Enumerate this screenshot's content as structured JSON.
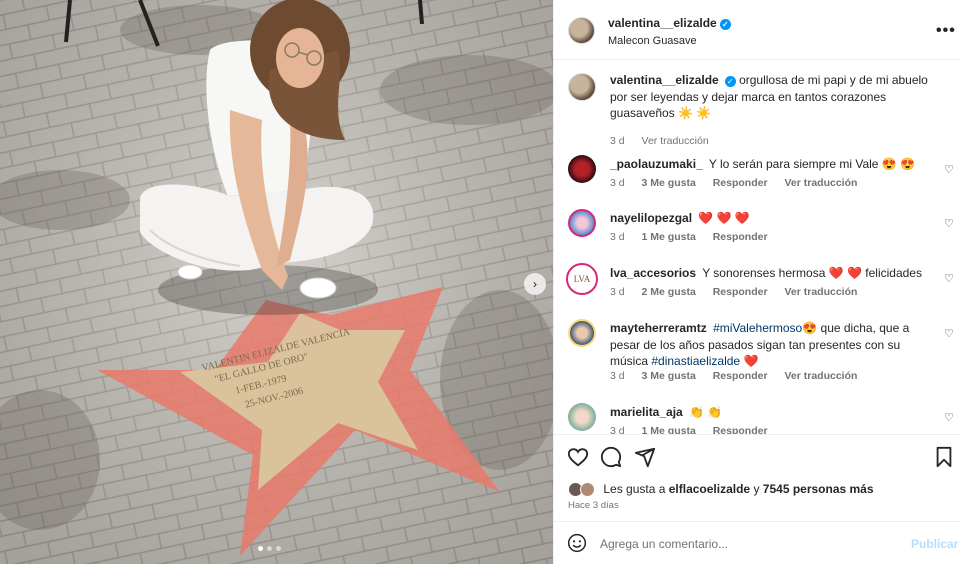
{
  "post": {
    "author": "valentina__elizalde",
    "location": "Malecon Guasave",
    "more_icon": "more-horizontal-icon",
    "caption": "orgullosa de mi papi y de mi abuelo por ser leyendas y dejar marca en tantos corazones guasaveños",
    "caption_emoji": "☀️ ☀️",
    "caption_time": "3 d",
    "caption_translate": "Ver traducción",
    "star_plaque": {
      "line1": "VALENTIN ELIZALDE VALENCIA",
      "line2": "\"EL GALLO DE ORO\"",
      "line3": "1-FEB.-1979",
      "line4": "25-NOV.-2006"
    }
  },
  "comments": [
    {
      "user": "_paolauzumaki_",
      "text": "Y lo serán para siempre mi Vale",
      "emoji": "😍 😍",
      "time": "3 d",
      "likes": "3 Me gusta",
      "reply": "Responder",
      "translate": "Ver traducción"
    },
    {
      "user": "nayelilopezgal",
      "text": "",
      "emoji": "❤️ ❤️ ❤️",
      "time": "3 d",
      "likes": "1 Me gusta",
      "reply": "Responder",
      "translate": ""
    },
    {
      "user": "lva_accesorios",
      "text": "Y sonorenses hermosa",
      "emoji": "❤️ ❤️",
      "text2": "felicidades",
      "time": "3 d",
      "likes": "2 Me gusta",
      "reply": "Responder",
      "translate": "Ver traducción",
      "avatar_text": "LVA"
    },
    {
      "user": "mayteherreramtz",
      "tag": "#miValehermoso",
      "emoji": "😍",
      "text": "que dicha, que a pesar de los años pasados sigan tan presentes con su música",
      "tag2": "#dinastiaelizalde",
      "emoji2": "❤️",
      "time": "3 d",
      "likes": "3 Me gusta",
      "reply": "Responder",
      "translate": "Ver traducción"
    },
    {
      "user": "marielita_aja",
      "text": "",
      "emoji": "👏 👏",
      "time": "3 d",
      "likes": "1 Me gusta",
      "reply": "Responder",
      "translate": ""
    }
  ],
  "actions": {
    "like_icon": "heart-icon",
    "comment_icon": "comment-icon",
    "share_icon": "share-icon",
    "save_icon": "bookmark-icon",
    "likes_prefix": "Les gusta a",
    "likes_user": "elflacoelizalde",
    "likes_joiner": "y",
    "likes_count": "7545 personas más",
    "posted": "Hace 3 días"
  },
  "add_comment": {
    "placeholder": "Agrega un comentario...",
    "post_label": "Publicar",
    "emoji_icon": "smile-icon"
  },
  "carousel": {
    "next_icon": "chevron-right-icon",
    "slides": 3,
    "active": 1
  },
  "colors": {
    "verified": "#0095f6",
    "link": "#00376b",
    "post_disabled": "#b2dffc",
    "star_paint": "#e8796a"
  }
}
